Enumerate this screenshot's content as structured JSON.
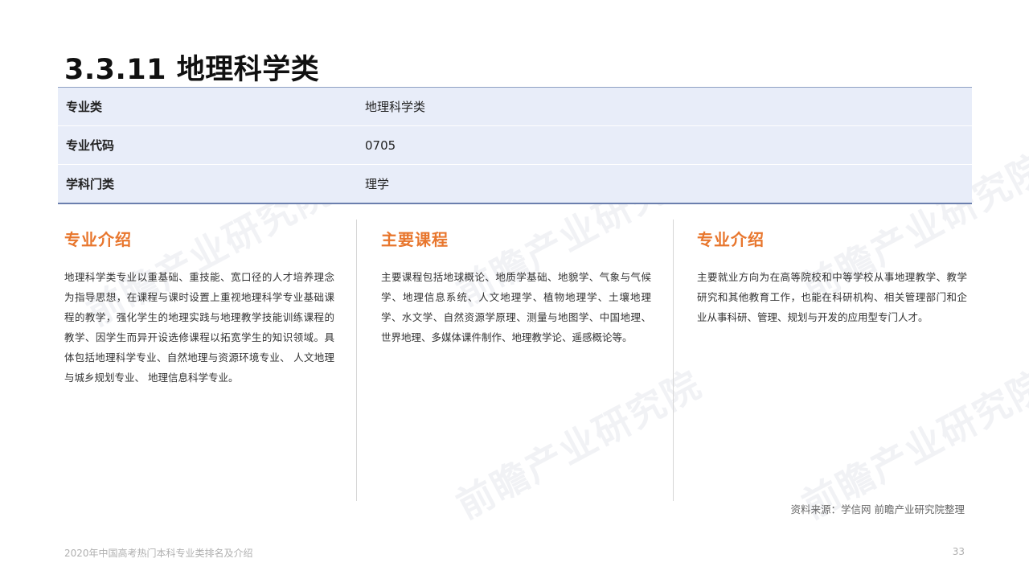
{
  "title": "3.3.11 地理科学类",
  "watermark": "前瞻产业研究院",
  "info_table": [
    {
      "key": "专业类",
      "value": "地理科学类"
    },
    {
      "key": "专业代码",
      "value": "0705"
    },
    {
      "key": "学科门类",
      "value": "理学"
    }
  ],
  "columns": [
    {
      "heading": "专业介绍",
      "body": "地理科学类专业以重基础、重技能、宽口径的人才培养理念为指导思想，在课程与课时设置上重视地理科学专业基础课程的教学，强化学生的地理实践与地理教学技能训练课程的教学、因学生而异开设选修课程以拓宽学生的知识领域。具体包括地理科学专业、自然地理与资源环境专业、 人文地理与城乡规划专业、 地理信息科学专业。"
    },
    {
      "heading": "主要课程",
      "body": "主要课程包括地球概论、地质学基础、地貌学、气象与气候学、地理信息系统、人文地理学、植物地理学、土壤地理学、水文学、自然资源学原理、测量与地图学、中国地理、世界地理、多媒体课件制作、地理教学论、遥感概论等。"
    },
    {
      "heading": "专业介绍",
      "body": "主要就业方向为在高等院校和中等学校从事地理教学、教学研究和其他教育工作，也能在科研机构、相关管理部门和企业从事科研、管理、规划与开发的应用型专门人才。"
    }
  ],
  "source": "资料来源：学信网 前瞻产业研究院整理",
  "footer": {
    "doc_title": "2020年中国高考热门本科专业类排名及介绍",
    "page_number": "33"
  }
}
